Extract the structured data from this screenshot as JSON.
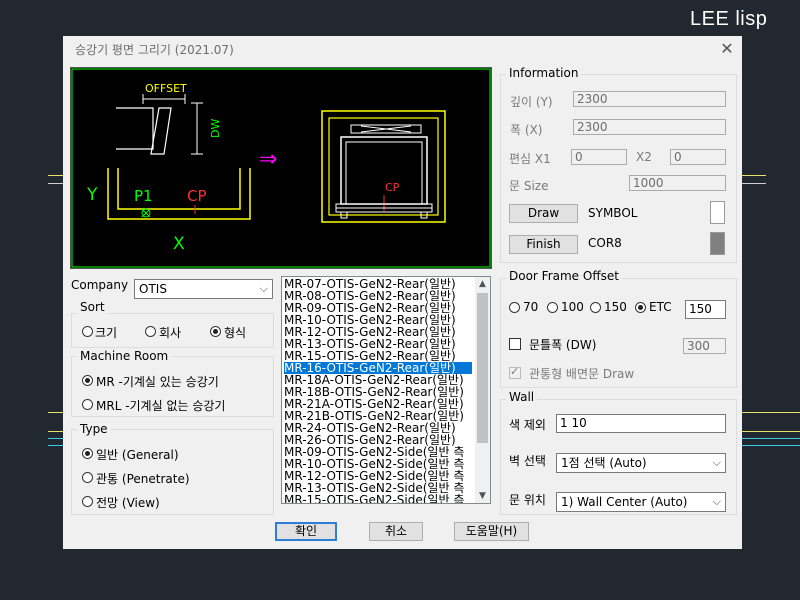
{
  "brand": "LEE lisp",
  "dialog": {
    "title": "승강기 평면 그리기 (2021.07)",
    "close": "✕"
  },
  "preview": {
    "offset": "OFFSET",
    "dw": "DW",
    "y": "Y",
    "p1": "P1",
    "cp": "CP",
    "x": "X",
    "arrow": "⇒",
    "cp2": "CP"
  },
  "company": {
    "label": "Company",
    "value": "OTIS"
  },
  "sort": {
    "title": "Sort",
    "options": [
      "크기",
      "회사",
      "형식"
    ],
    "selected": "형식"
  },
  "machine_room": {
    "title": "Machine Room",
    "options": [
      "MR  -기계실 있는 승강기",
      "MRL -기계실 없는 승강기"
    ],
    "selected": "MR  -기계실 있는 승강기"
  },
  "type": {
    "title": "Type",
    "options": [
      "일반 (General)",
      "관통 (Penetrate)",
      "전망 (View)"
    ],
    "selected": "일반 (General)"
  },
  "list": {
    "items": [
      "MR-07-OTIS-GeN2-Rear(일반)",
      "MR-08-OTIS-GeN2-Rear(일반)",
      "MR-09-OTIS-GeN2-Rear(일반)",
      "MR-10-OTIS-GeN2-Rear(일반)",
      "MR-12-OTIS-GeN2-Rear(일반)",
      "MR-13-OTIS-GeN2-Rear(일반)",
      "MR-15-OTIS-GeN2-Rear(일반)",
      "MR-16-OTIS-GeN2-Rear(일반)",
      "MR-18A-OTIS-GeN2-Rear(일반)",
      "MR-18B-OTIS-GeN2-Rear(일반)",
      "MR-21A-OTIS-GeN2-Rear(일반)",
      "MR-21B-OTIS-GeN2-Rear(일반)",
      "MR-24-OTIS-GeN2-Rear(일반)",
      "MR-26-OTIS-GeN2-Rear(일반)",
      "MR-09-OTIS-GeN2-Side(일반 측",
      "MR-10-OTIS-GeN2-Side(일반 측",
      "MR-12-OTIS-GeN2-Side(일반 측",
      "MR-13-OTIS-GeN2-Side(일반 측",
      "MR-15-OTIS-GeN2-Side(일반 측"
    ],
    "selected": "MR-16-OTIS-GeN2-Rear(일반)",
    "scroll_up": "▲",
    "scroll_down": "▼"
  },
  "information": {
    "title": "Information",
    "depth_label": "깊이 (Y)",
    "depth_value": "2300",
    "width_label": "폭 (X)",
    "width_value": "2300",
    "offset_label": "편심 X1",
    "x1_value": "0",
    "x2_label": "X2",
    "x2_value": "0",
    "door_size_label": "문 Size",
    "door_size_value": "1000",
    "draw_button": "Draw",
    "draw_name": "SYMBOL",
    "draw_color": "#ffffff",
    "finish_button": "Finish",
    "finish_name": "COR8",
    "finish_color": "#808080"
  },
  "door_frame": {
    "title": "Door Frame Offset",
    "options": [
      "70",
      "100",
      "150",
      "ETC"
    ],
    "selected": "ETC",
    "etc_value": "150",
    "dw_label": "문틀폭 (DW)",
    "dw_value": "300",
    "penetrate_label": "관통형 배면문 Draw"
  },
  "wall": {
    "title": "Wall",
    "exclude_label": "색 제외",
    "exclude_value": "1 10",
    "select_label": "벽 선택",
    "select_value": "1점 선택 (Auto)",
    "door_pos_label": "문 위치",
    "door_pos_value": "1) Wall Center (Auto)"
  },
  "buttons": {
    "ok": "확인",
    "cancel": "취소",
    "help": "도움말(H)"
  }
}
